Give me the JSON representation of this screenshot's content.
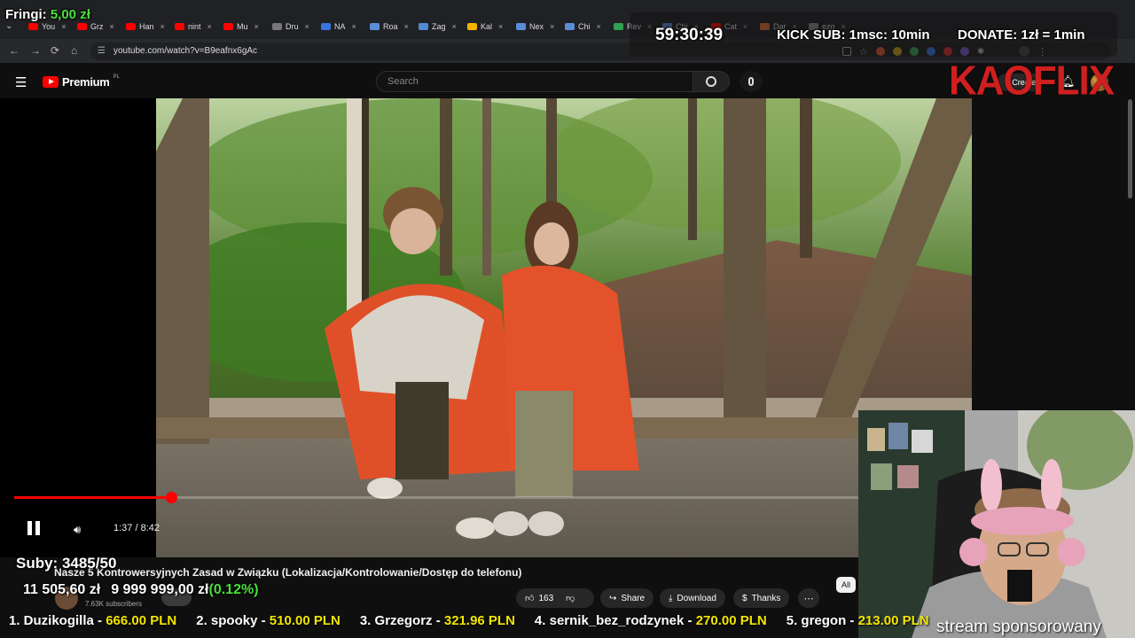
{
  "stream": {
    "fringi_label": "Fringi:",
    "fringi_value": "5,00 zł",
    "timer": "59:30:39",
    "kick_sub": "KICK SUB: 1msc: 10min",
    "donate": "DONATE: 1zł = 1min",
    "logo": "KAOFLIX",
    "subs": "Suby: 3485/50",
    "money": "11 505,60 zł",
    "goal": "9 999 999,00 zł",
    "goal_pct": "(0.12%)",
    "sponsored": "stream sponsorowany",
    "top_donors": [
      {
        "rank": "1. Duzikogilla",
        "amount": "666.00 PLN"
      },
      {
        "rank": "2. spooky",
        "amount": "510.00 PLN"
      },
      {
        "rank": "3. Grzegorz",
        "amount": "321.96 PLN"
      },
      {
        "rank": "4. sernik_bez_rodzynek",
        "amount": "270.00 PLN"
      },
      {
        "rank": "5. gregon",
        "amount": "213.00 PLN"
      }
    ],
    "colors": {
      "green": "#48e03a",
      "yellow": "#f3e600",
      "red": "#ff0000"
    }
  },
  "browser": {
    "tabs": [
      "You",
      "Grz",
      "Han",
      "nint",
      "Mu",
      "Dru",
      "NA",
      "Roa",
      "Zag",
      "Kal",
      "Nex",
      "Chi",
      "Rev",
      "Chi",
      "Cat",
      "Dar",
      "ezg"
    ],
    "url": "youtube.com/watch?v=B9eafnx6gAc"
  },
  "youtube": {
    "brand": "Premium",
    "region": "PL",
    "search_placeholder": "Search",
    "create": "Create",
    "player": {
      "time": "1:37 / 8:42",
      "progress_fraction": 0.186
    },
    "video_title": "Nasze 5 Kontrowersyjnych Zasad w Związku (Lokalizacja/Kontrolowanie/Dostęp do telefonu)",
    "channel_subs": "7.63K subscribers",
    "likes": "163",
    "share": "Share",
    "download": "Download",
    "thanks": "Thanks",
    "chip_all": "All"
  }
}
